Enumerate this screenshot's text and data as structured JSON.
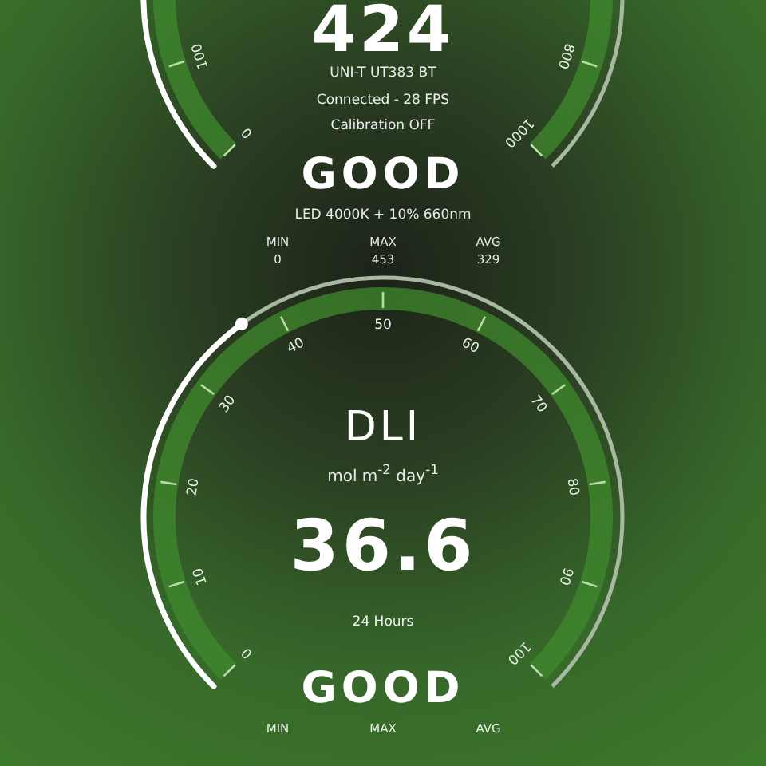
{
  "gauges": [
    {
      "value": "424",
      "ticks_start": [
        "0",
        "100"
      ],
      "ticks_end": [
        "800",
        "1000"
      ],
      "lines": [
        "UNI-T UT383 BT",
        "Connected - 28 FPS",
        "Calibration OFF"
      ],
      "status": "GOOD",
      "note": "LED 4000K + 10% 660nm",
      "stats": [
        {
          "label": "MIN",
          "value": "0"
        },
        {
          "label": "MAX",
          "value": "453"
        },
        {
          "label": "AVG",
          "value": "329"
        }
      ]
    },
    {
      "title": "DLI",
      "unit": "mol m$^{-2}$ day$^{-1}$",
      "value": "36.6",
      "ticks_start": [
        "0",
        "10",
        "20",
        "30",
        "40",
        "50",
        "60",
        "70",
        "80",
        "90",
        "100"
      ],
      "lines": [
        "24 Hours"
      ],
      "status": "GOOD",
      "stats": [
        {
          "label": "MIN"
        },
        {
          "label": "MAX"
        },
        {
          "label": "AVG"
        }
      ]
    }
  ]
}
